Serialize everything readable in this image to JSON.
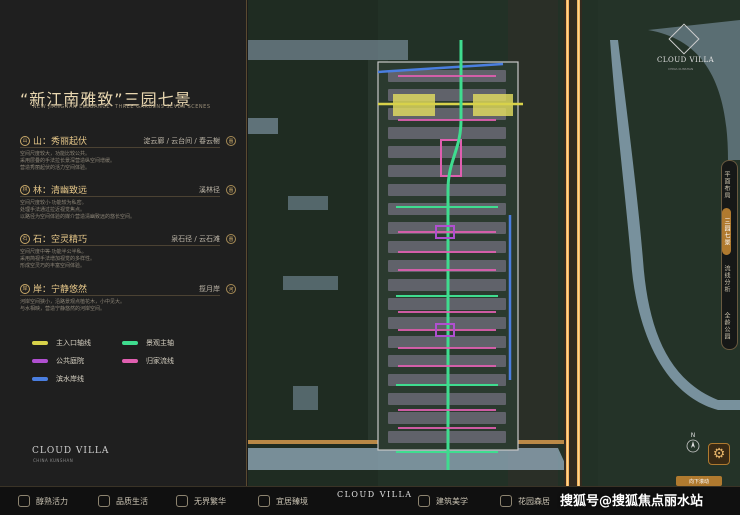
{
  "panel": {
    "title": "“新江南雅致”三园七景",
    "subtitle": "\"NEW JIANGNAN ELEGANCE\" THREE GARDENS SEVEN SCENES",
    "scenes": [
      {
        "icon": "山",
        "name": "山：秀丽起伏",
        "path": "淀云廊 / 云台间 / 春云榭",
        "badge": "惠",
        "desc": "空间尺度较大，功能比较公共。\n采用层叠的手法拉长景深营造纵空间增缓。\n营造秀丽起伏的活力空间体验。"
      },
      {
        "icon": "林",
        "name": "林：清幽致远",
        "path": "溪林径",
        "badge": "惠",
        "desc": "空间尺度较小·功能较为私密。\n处理手法通过拉近视觉焦点。\n以路径为空间体验的媒介营造清幽致远的悠长空间。"
      },
      {
        "icon": "石",
        "name": "石：空灵精巧",
        "path": "泉石径 / 云石滩",
        "badge": "惠",
        "desc": "空间尺度中等·功能半公半私。\n采用简视手法增加视觉的多样性。\n形成空灵巧的丰富空间体验。"
      },
      {
        "icon": "岸",
        "name": "岸：宁静悠然",
        "path": "揽月岸",
        "badge": "河",
        "desc": "河岸空间狭小，沿路景观点植花木，小中见大。\n与水相映，营造宁静悠然的河岸空间。"
      }
    ],
    "legend": [
      {
        "label": "主入口轴线",
        "color": "#d8d24a"
      },
      {
        "label": "景观主轴",
        "color": "#3fdc8f"
      },
      {
        "label": "公共庭院",
        "color": "#b04fd0"
      },
      {
        "label": "归家流线",
        "color": "#e05fb0"
      },
      {
        "label": "滨水岸线",
        "color": "#4a7ee0"
      }
    ],
    "brand": "CLOUD VILLA",
    "brand_sub": "CHINA KUNSHAN"
  },
  "map": {
    "brand": "CLOUD VILLA",
    "brand_sub": "CHINA KUNSHAN",
    "compass": "N",
    "scroll_hint": "向下滚动",
    "side_tabs": [
      {
        "label": "平面布局",
        "active": false
      },
      {
        "label": "三园七景",
        "active": true
      },
      {
        "label": "流线分析",
        "active": false
      },
      {
        "label": "全龄公园",
        "active": false
      }
    ]
  },
  "bottom_nav": {
    "items": [
      "醇熟活力",
      "品质生活",
      "无界繁华",
      "宜居臻境",
      "建筑美学",
      "花园森居"
    ],
    "center_brand": "CLOUD VILLA"
  },
  "watermark": "搜狐号@搜狐焦点丽水站"
}
